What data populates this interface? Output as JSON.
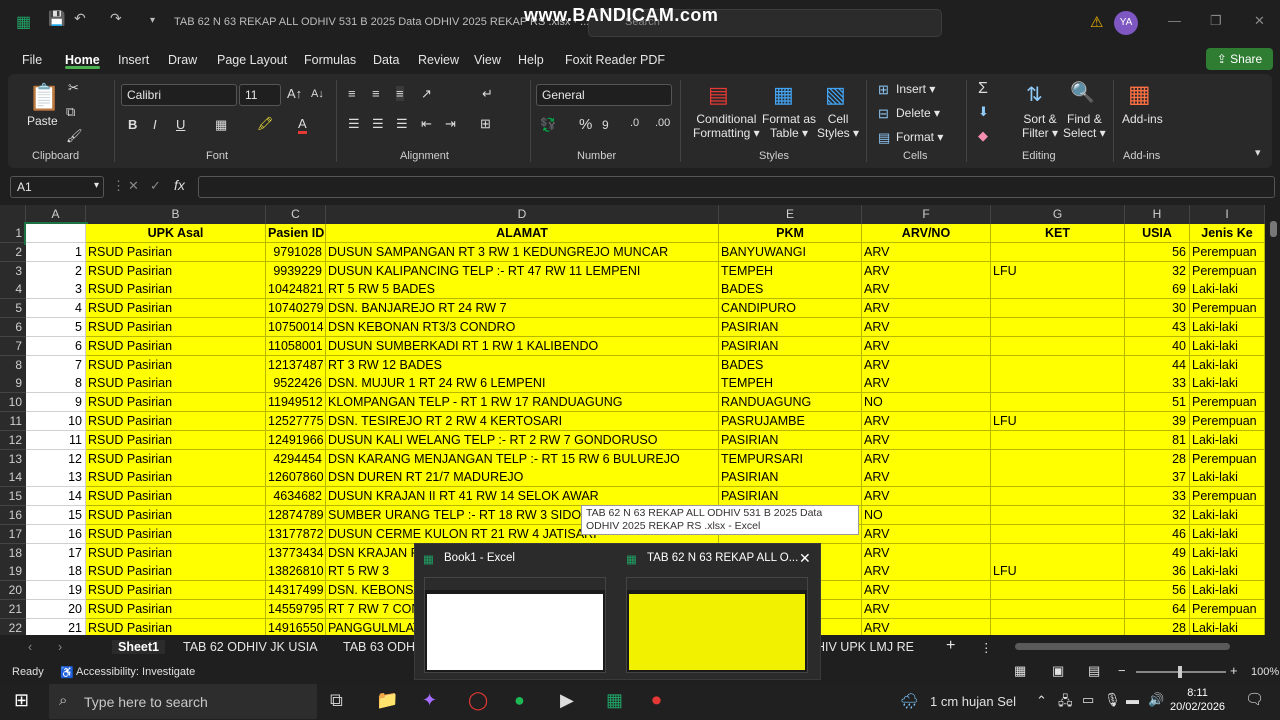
{
  "window": {
    "title": "TAB 62 N 63 REKAP ALL ODHIV 531 B 2025 Data ODHIV 2025 REKAP RS .xlsx · ...",
    "watermark": "www.BANDICAM.com",
    "search_placeholder": "Search",
    "avatar_initials": "YA"
  },
  "menu": [
    "File",
    "Home",
    "Insert",
    "Draw",
    "Page Layout",
    "Formulas",
    "Data",
    "Review",
    "View",
    "Help",
    "Foxit Reader PDF"
  ],
  "share_label": "Share",
  "ribbon": {
    "clipboard": {
      "paste": "Paste",
      "label": "Clipboard"
    },
    "font": {
      "name": "Calibri",
      "size": "11",
      "label": "Font"
    },
    "alignment": {
      "label": "Alignment"
    },
    "number": {
      "format": "General",
      "label": "Number"
    },
    "styles": {
      "conditional": "Conditional\nFormatting",
      "format_table": "Format as\nTable",
      "cell_styles": "Cell\nStyles",
      "label": "Styles"
    },
    "cells": {
      "insert": "Insert",
      "delete": "Delete",
      "format": "Format",
      "label": "Cells"
    },
    "editing": {
      "sort": "Sort &\nFilter",
      "find": "Find &\nSelect",
      "label": "Editing"
    },
    "addins": {
      "button": "Add-ins",
      "label": "Add-ins"
    }
  },
  "namebox": "A1",
  "fx_label": "fx",
  "columns": [
    "A",
    "B",
    "C",
    "D",
    "E",
    "F",
    "G",
    "H",
    "I"
  ],
  "headers": [
    "",
    "UPK Asal",
    "Pasien ID",
    "ALAMAT",
    "PKM",
    "ARV/NO",
    "KET",
    "USIA",
    "Jenis Ke"
  ],
  "rows": [
    [
      "1",
      "RSUD Pasirian",
      "9791028",
      "DUSUN SAMPANGAN RT 3 RW 1 KEDUNGREJO MUNCAR",
      "BANYUWANGI",
      "ARV",
      "",
      "56",
      "Perempuan"
    ],
    [
      "2",
      "RSUD Pasirian",
      "9939229",
      "DUSUN KALIPANCING TELP :- RT 47 RW 11 LEMPENI",
      "TEMPEH",
      "ARV",
      "LFU",
      "32",
      "Perempuan"
    ],
    [
      "3",
      "RSUD Pasirian",
      "10424821",
      "RT 5 RW 5 BADES",
      "BADES",
      "ARV",
      "",
      "69",
      "Laki-laki"
    ],
    [
      "4",
      "RSUD Pasirian",
      "10740279",
      "DSN. BANJAREJO RT 24 RW 7",
      "CANDIPURO",
      "ARV",
      "",
      "30",
      "Perempuan"
    ],
    [
      "5",
      "RSUD Pasirian",
      "10750014",
      "DSN KEBONAN RT3/3 CONDRO",
      "PASIRIAN",
      "ARV",
      "",
      "43",
      "Laki-laki"
    ],
    [
      "6",
      "RSUD Pasirian",
      "11058001",
      "DUSUN SUMBERKADI RT 1 RW 1 KALIBENDO",
      "PASIRIAN",
      "ARV",
      "",
      "40",
      "Laki-laki"
    ],
    [
      "7",
      "RSUD Pasirian",
      "12137487",
      "RT 3 RW 12 BADES",
      "BADES",
      "ARV",
      "",
      "44",
      "Laki-laki"
    ],
    [
      "8",
      "RSUD Pasirian",
      "9522426",
      "DSN. MUJUR 1 RT 24 RW 6 LEMPENI",
      "TEMPEH",
      "ARV",
      "",
      "33",
      "Laki-laki"
    ],
    [
      "9",
      "RSUD Pasirian",
      "11949512",
      "KLOMPANGAN TELP - RT 1 RW 17 RANDUAGUNG",
      "RANDUAGUNG",
      "NO",
      "",
      "51",
      "Perempuan"
    ],
    [
      "10",
      "RSUD Pasirian",
      "12527775",
      "DSN. TESIREJO RT 2 RW 4 KERTOSARI",
      "PASRUJAMBE",
      "ARV",
      "LFU",
      "39",
      "Perempuan"
    ],
    [
      "11",
      "RSUD Pasirian",
      "12491966",
      "DUSUN KALI WELANG TELP :- RT 2 RW 7 GONDORUSO",
      "PASIRIAN",
      "ARV",
      "",
      "81",
      "Laki-laki"
    ],
    [
      "12",
      "RSUD Pasirian",
      "4294454",
      "DSN KARANG MENJANGAN TELP :- RT 15 RW 6 BULUREJO",
      "TEMPURSARI",
      "ARV",
      "",
      "28",
      "Perempuan"
    ],
    [
      "13",
      "RSUD Pasirian",
      "12607860",
      "DSN DUREN RT 21/7 MADUREJO",
      "PASIRIAN",
      "ARV",
      "",
      "37",
      "Laki-laki"
    ],
    [
      "14",
      "RSUD Pasirian",
      "4634682",
      "DUSUN KRAJAN II RT 41 RW 14 SELOK AWAR",
      "PASIRIAN",
      "ARV",
      "",
      "33",
      "Perempuan"
    ],
    [
      "15",
      "RSUD Pasirian",
      "12874789",
      "SUMBER URANG TELP :- RT 18 RW 3 SIDOMUL",
      "",
      "NO",
      "",
      "32",
      "Laki-laki"
    ],
    [
      "16",
      "RSUD Pasirian",
      "13177872",
      "DUSUN CERME KULON RT 21 RW 4 JATISARI",
      "",
      "ARV",
      "",
      "46",
      "Laki-laki"
    ],
    [
      "17",
      "RSUD Pasirian",
      "13773434",
      "DSN KRAJAN RT",
      "",
      "ARV",
      "",
      "49",
      "Laki-laki"
    ],
    [
      "18",
      "RSUD Pasirian",
      "13826810",
      "RT 5 RW 3",
      "",
      "ARV",
      "LFU",
      "36",
      "Laki-laki"
    ],
    [
      "19",
      "RSUD Pasirian",
      "14317499",
      "DSN. KEBONSA",
      "",
      "ARV",
      "",
      "56",
      "Laki-laki"
    ],
    [
      "20",
      "RSUD Pasirian",
      "14559795",
      "RT 7 RW 7 CON",
      "",
      "ARV",
      "",
      "64",
      "Perempuan"
    ],
    [
      "21",
      "RSUD Pasirian",
      "14916550",
      "PANGGULMLAT",
      "",
      "ARV",
      "",
      "28",
      "Laki-laki"
    ]
  ],
  "row_numbers": [
    "1",
    "2",
    "3",
    "4",
    "5",
    "6",
    "7",
    "8",
    "9",
    "10",
    "11",
    "12",
    "13",
    "14",
    "15",
    "16",
    "17",
    "18",
    "19",
    "20",
    "21",
    "22"
  ],
  "sheet_tabs": [
    "Sheet1",
    "TAB 62 ODHIV JK USIA",
    "TAB 63 ODH",
    "HIV UPK LMJ RE"
  ],
  "status": {
    "ready": "Ready",
    "accessibility": "Accessibility: Investigate",
    "zoom": "100%"
  },
  "tooltip": "TAB 62 N 63 REKAP ALL ODHIV 531 B 2025 Data ODHIV 2025 REKAP RS .xlsx - Excel",
  "thumbnails": [
    {
      "title": "Book1 - Excel"
    },
    {
      "title": "TAB 62 N 63 REKAP ALL O..."
    }
  ],
  "taskbar": {
    "search_placeholder": "Type here to search",
    "weather": "1 cm hujan Sel",
    "time": "8:11",
    "date": "20/02/2026"
  }
}
